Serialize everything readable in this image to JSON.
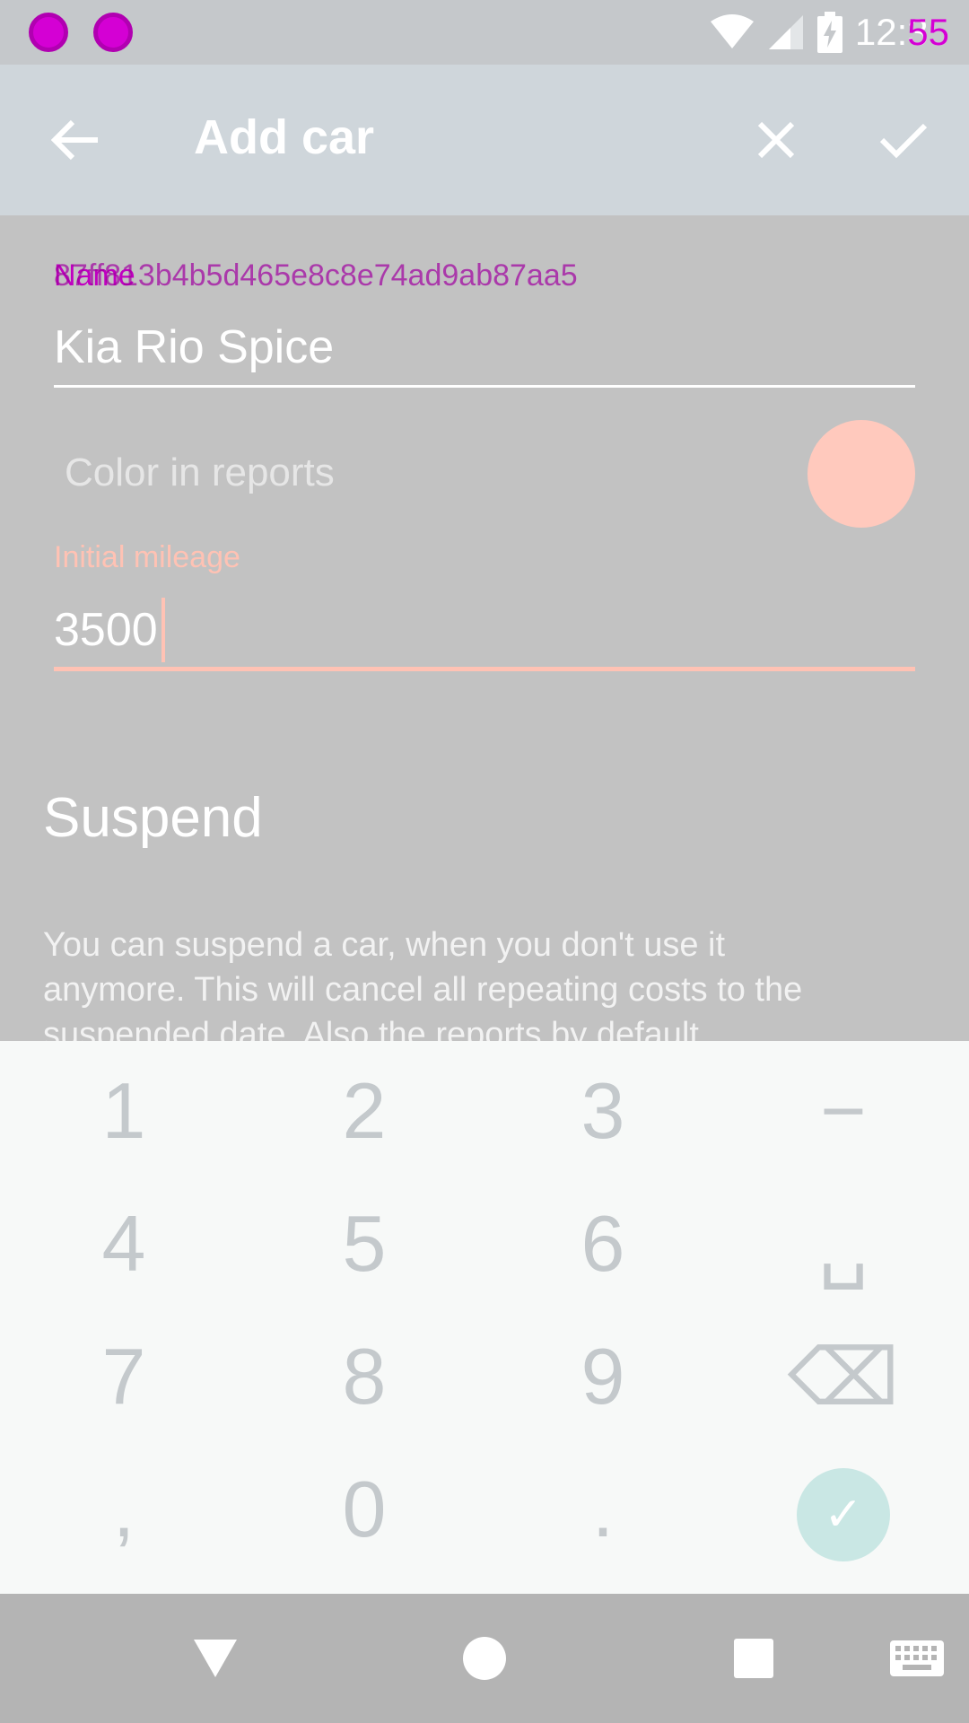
{
  "status_bar": {
    "time": "12:35",
    "time_overlay": "55",
    "icons": [
      "notification-icon",
      "notification-icon",
      "wifi-icon",
      "signal-icon",
      "battery-charging-icon"
    ]
  },
  "app_bar": {
    "title": "Add car",
    "icons": [
      "back-arrow-icon",
      "close-icon",
      "check-icon"
    ]
  },
  "form": {
    "name_label": "Name",
    "name_label_overlay": "87ff813b4b5d465e8c8e74ad9ab87aa5",
    "name_value": "Kia Rio Spice",
    "color_label": "Color in reports",
    "color_value": "#ffc9bd",
    "mileage_label": "Initial mileage",
    "mileage_value": "3500",
    "section_title": "Suspend",
    "section_description": "You can suspend a car, when you don't use it anymore. This will cancel all repeating costs to the suspended date. Also the reports by default"
  },
  "keypad": {
    "keys": [
      "1",
      "2",
      "3",
      "−",
      "4",
      "5",
      "6",
      "␣",
      "7",
      "8",
      "9",
      "⌫",
      ",",
      "0",
      ".",
      "✓"
    ]
  },
  "nav_bar": {
    "icons": [
      "back-triangle-icon",
      "home-circle-icon",
      "recents-square-icon",
      "keyboard-icon"
    ]
  },
  "colors": {
    "accent": "#ffc2b4",
    "background": "#c2c2c2",
    "app_bar": "#cfd6db",
    "keypad": "#f7f9f8",
    "done_button": "#c9e7e4"
  }
}
